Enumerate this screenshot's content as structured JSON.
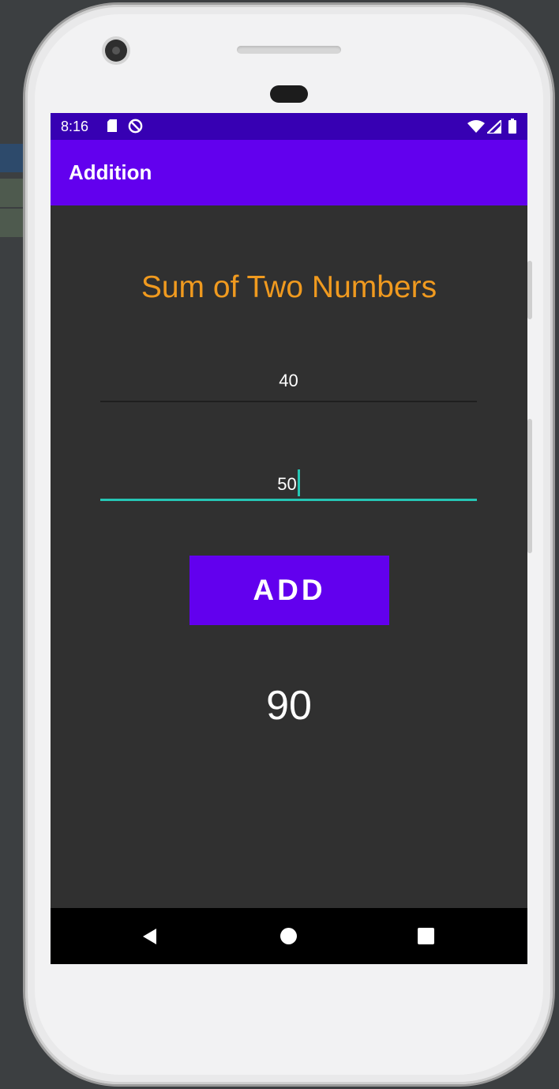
{
  "status_bar": {
    "time": "8:16",
    "icons": [
      "sd-card-icon",
      "do-not-disturb-icon",
      "wifi-icon",
      "signal-icon",
      "battery-icon"
    ]
  },
  "app_bar": {
    "title": "Addition"
  },
  "main": {
    "heading": "Sum of Two Numbers",
    "first_number": {
      "value": "40"
    },
    "second_number": {
      "value": "50"
    },
    "add_button_label": "ADD",
    "result": "90"
  },
  "nav_bar": {
    "icons": [
      "back-icon",
      "home-icon",
      "recents-icon"
    ]
  },
  "colors": {
    "status_bar": "#3700b3",
    "app_bar": "#6200ee",
    "screen_background": "#303030",
    "heading": "#f09a1f",
    "focused_underline": "#26c6b5",
    "button": "#6200ee"
  }
}
